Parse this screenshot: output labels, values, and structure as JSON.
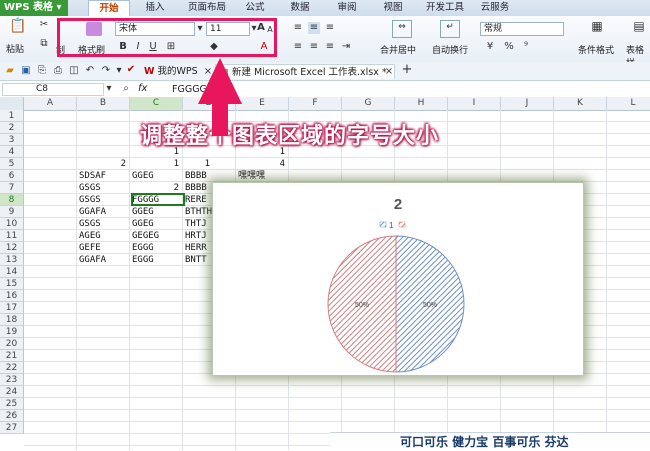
{
  "app": {
    "name": "WPS 表格"
  },
  "menu_tabs": [
    "开始",
    "插入",
    "页面布局",
    "公式",
    "数据",
    "审阅",
    "视图",
    "开发工具",
    "云服务"
  ],
  "ribbon": {
    "paste_label": "粘贴",
    "cut_label": "制",
    "format_painter_label": "格式刷",
    "font_name": "宋体",
    "font_size": "11",
    "merge_label": "合并居中",
    "wrap_label": "自动换行",
    "number_format": "常规",
    "cond_format_label": "条件格式",
    "table_style_label": "表格样"
  },
  "doc_tabs": [
    {
      "label": "我的WPS"
    },
    {
      "label": "新建 Microsoft Excel 工作表.xlsx *"
    }
  ],
  "formula_bar": {
    "cell_ref": "C8",
    "fx": "fx",
    "value": "FGGGG"
  },
  "columns": [
    "A",
    "B",
    "C",
    "D",
    "E",
    "F",
    "G",
    "H",
    "I",
    "J",
    "K",
    "L"
  ],
  "rows": [
    "1",
    "2",
    "3",
    "4",
    "5",
    "6",
    "7",
    "8",
    "9",
    "10",
    "11",
    "12",
    "13",
    "14",
    "15",
    "16",
    "17",
    "18",
    "19",
    "20",
    "21",
    "22",
    "23",
    "24",
    "25",
    "26",
    "27"
  ],
  "cells": {
    "C4": "1",
    "E4": "1",
    "B5": "2",
    "C5": "1",
    "D5": "1",
    "E5": "4",
    "B6": "SDSAF",
    "C6": "GGEG",
    "D6": "BBBB",
    "E6": "嘿嘿嘿",
    "B7": "GSGS",
    "C7": "2",
    "D7": "BBBB",
    "B8": "GSGS",
    "C8": "FGGGG",
    "D8": "RERE",
    "B9": "GGAFA",
    "C9": "GGEG",
    "D9": "BTHTH",
    "B10": "GSGS",
    "C10": "GGEG",
    "D10": "THTJ",
    "B11": "AGEG",
    "C11": "GEGEG",
    "D11": "HRTJ",
    "B12": "GEFE",
    "C12": "EGGG",
    "D12": "HERR",
    "B13": "GGAFA",
    "C13": "EGGG",
    "D13": "BNTT"
  },
  "annotation": "调整整个图表区域的字号大小",
  "colors": {
    "annotation": "#e8175d",
    "accent_green": "#3a9a3a",
    "pie_blue": "#6f8fc8",
    "pie_red": "#d08080"
  },
  "chart_data": {
    "type": "pie",
    "title": "2",
    "legend": [
      "1",
      ""
    ],
    "legend_position": "top",
    "slices": [
      {
        "label": "50%",
        "value": 50,
        "color": "#6f8fc8"
      },
      {
        "label": "50%",
        "value": 50,
        "color": "#d08080"
      }
    ]
  },
  "footer_text": "可口可乐 健力宝 百事可乐 芬达"
}
